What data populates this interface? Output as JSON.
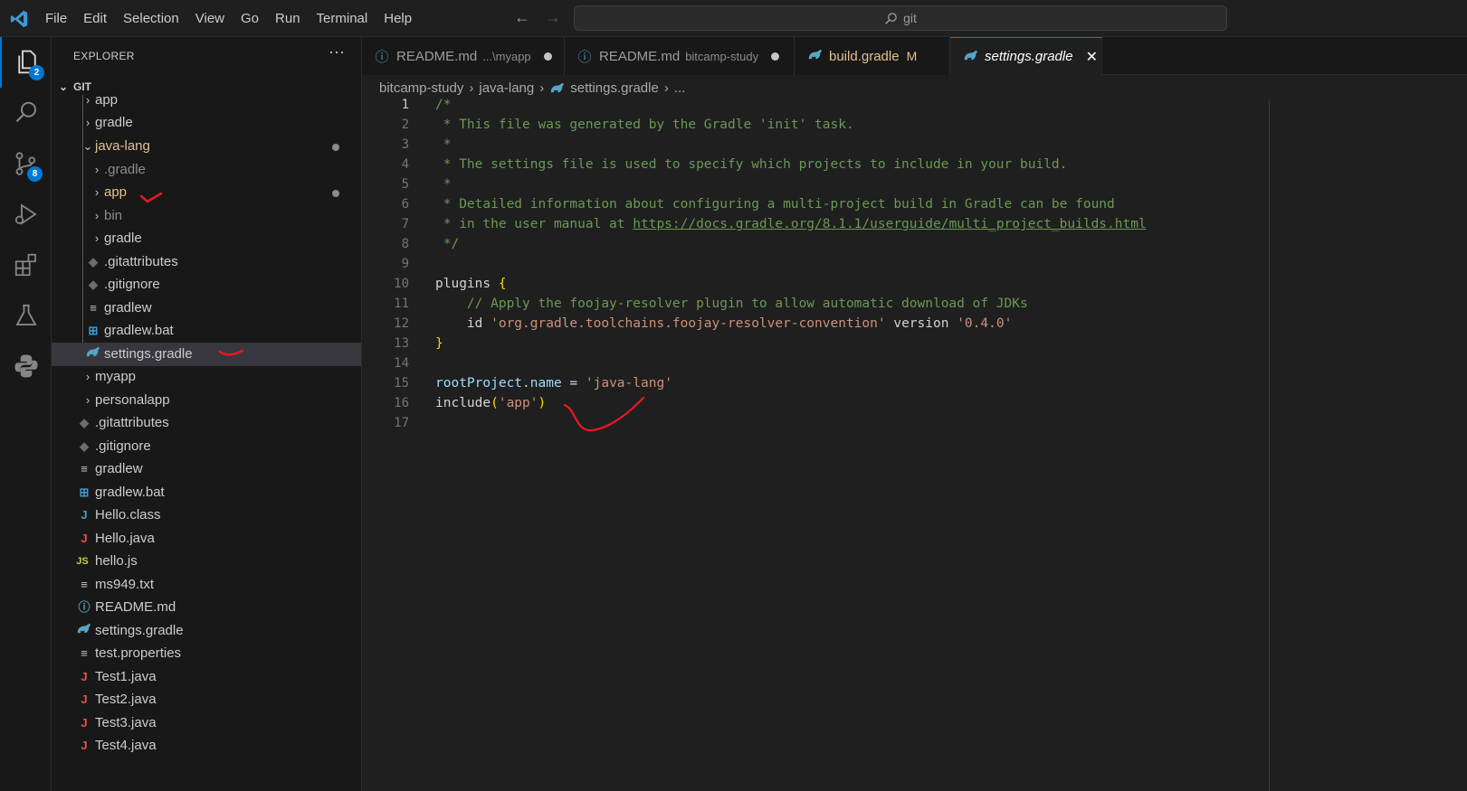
{
  "menu": [
    "File",
    "Edit",
    "Selection",
    "View",
    "Go",
    "Run",
    "Terminal",
    "Help"
  ],
  "command_center": {
    "text": "git"
  },
  "activity": {
    "explorer_badge": "2",
    "scm_badge": "8"
  },
  "sidebar": {
    "title": "EXPLORER",
    "more": "···",
    "section": "GIT",
    "items": [
      {
        "label": "app"
      },
      {
        "label": "gradle"
      },
      {
        "label": "java-lang"
      },
      {
        "label": ".gradle"
      },
      {
        "label": "app"
      },
      {
        "label": "bin"
      },
      {
        "label": "gradle"
      },
      {
        "label": ".gitattributes"
      },
      {
        "label": ".gitignore"
      },
      {
        "label": "gradlew"
      },
      {
        "label": "gradlew.bat"
      },
      {
        "label": "settings.gradle"
      },
      {
        "label": "myapp"
      },
      {
        "label": "personalapp"
      },
      {
        "label": ".gitattributes"
      },
      {
        "label": ".gitignore"
      },
      {
        "label": "gradlew"
      },
      {
        "label": "gradlew.bat"
      },
      {
        "label": "Hello.class"
      },
      {
        "label": "Hello.java"
      },
      {
        "label": "hello.js"
      },
      {
        "label": "ms949.txt"
      },
      {
        "label": "README.md"
      },
      {
        "label": "settings.gradle"
      },
      {
        "label": "test.properties"
      },
      {
        "label": "Test1.java"
      },
      {
        "label": "Test2.java"
      },
      {
        "label": "Test3.java"
      },
      {
        "label": "Test4.java"
      }
    ],
    "icons": {
      "java": "J",
      "js": "JS",
      "class": "J"
    }
  },
  "tabs": [
    {
      "label": "README.md",
      "desc": "...\\myapp"
    },
    {
      "label": "README.md",
      "desc": "bitcamp-study"
    },
    {
      "label": "build.gradle",
      "status": "M"
    },
    {
      "label": "settings.gradle",
      "close": "✕"
    }
  ],
  "breadcrumb": [
    "bitcamp-study",
    "java-lang",
    "settings.gradle",
    "..."
  ],
  "breadcrumb_sep": "›",
  "editor": {
    "line_numbers": [
      "1",
      "2",
      "3",
      "4",
      "5",
      "6",
      "7",
      "8",
      "9",
      "10",
      "11",
      "12",
      "13",
      "14",
      "15",
      "16",
      "17"
    ],
    "current_line": "1",
    "lines": {
      "l1": "/*",
      "l2": " * This file was generated by the Gradle 'init' task.",
      "l3": " *",
      "l4": " * The settings file is used to specify which projects to include in your build.",
      "l5": " *",
      "l6": " * Detailed information about configuring a multi-project build in Gradle can be found",
      "l7_pre": " * in the user manual at ",
      "l7_link": "https://docs.gradle.org/8.1.1/userguide/multi_project_builds.html",
      "l8": " */",
      "l10_kw": "plugins",
      "l10_br": "{",
      "l11": "    // Apply the foojay-resolver plugin to allow automatic download of JDKs",
      "l12_id": "    id ",
      "l12_str": "'org.gradle.toolchains.foojay-resolver-convention'",
      "l12_ver": " version ",
      "l12_vstr": "'0.4.0'",
      "l13_br": "}",
      "l15_a": "rootProject",
      "l15_b": ".",
      "l15_c": "name",
      "l15_d": " = ",
      "l15_e": "'java-lang'",
      "l16_a": "include",
      "l16_b": "(",
      "l16_c": "'app'",
      "l16_d": ")"
    }
  },
  "colors": {
    "accent": "#0078d4",
    "modified": "#e2c08d",
    "java_icon": "#f14c4c",
    "class_icon": "#519aba",
    "js_icon": "#cbcb41",
    "gradle_icon": "#57a5c6",
    "annotation": "#e8181f"
  }
}
